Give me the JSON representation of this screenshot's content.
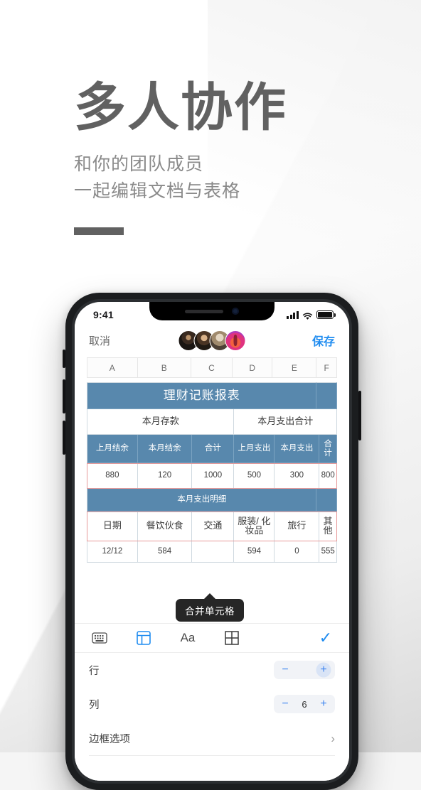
{
  "promo": {
    "title": "多人协作",
    "subtitle_line1": "和你的团队成员",
    "subtitle_line2": "一起编辑文档与表格"
  },
  "colors": {
    "title_gray": "#616161",
    "subtitle_gray": "#8a8a8a",
    "ios_blue": "#1f8cf0",
    "table_header_blue": "#5888ad",
    "selection_red": "#e79a9a",
    "stepper_blue": "#3d85f0"
  },
  "phone": {
    "status_bar": {
      "time": "9:41",
      "signal_icon": "cellular-bars-icon",
      "wifi_icon": "wifi-icon",
      "battery_icon": "battery-full-icon"
    },
    "nav_bar": {
      "cancel_label": "取消",
      "save_label": "保存",
      "collaborators": [
        {
          "name": "avatar-collaborator-1"
        },
        {
          "name": "avatar-collaborator-2"
        },
        {
          "name": "avatar-collaborator-3"
        },
        {
          "name": "avatar-collaborator-4"
        }
      ]
    },
    "spreadsheet": {
      "column_headers": [
        "A",
        "B",
        "C",
        "D",
        "E",
        "F"
      ],
      "title_row": "理财记账报表",
      "group_headers": [
        "本月存款",
        "本月支出合计"
      ],
      "income_headers": [
        "上月结余",
        "本月结余",
        "合计",
        "上月支出",
        "本月支出",
        "合计"
      ],
      "income_values": [
        "880",
        "120",
        "1000",
        "500",
        "300",
        "800"
      ],
      "detail_section_title": "本月支出明细",
      "detail_headers": [
        "日期",
        "餐饮伙食",
        "交通",
        "服装/ 化妆品",
        "旅行",
        "其他"
      ],
      "detail_values": [
        "12/12",
        "584",
        "",
        "594",
        "0",
        "555"
      ]
    },
    "tooltip": {
      "text": "合并单元格"
    },
    "toolbar": {
      "items": [
        {
          "icon": "keyboard-icon",
          "active": false
        },
        {
          "icon": "table-icon",
          "active": true
        },
        {
          "icon": "font-size-icon",
          "label": "Aa",
          "active": false
        },
        {
          "icon": "merge-cells-icon",
          "active": false
        }
      ],
      "confirm_icon": "checkmark-icon",
      "confirm_glyph": "✓"
    },
    "options_panel": {
      "rows": [
        {
          "label": "行",
          "type": "stepper",
          "minus": "−",
          "value": "",
          "plus": "+"
        },
        {
          "label": "列",
          "type": "stepper",
          "minus": "−",
          "value": "6",
          "plus": "+"
        },
        {
          "label": "边框选项",
          "type": "disclosure",
          "chevron": "›"
        }
      ]
    }
  }
}
